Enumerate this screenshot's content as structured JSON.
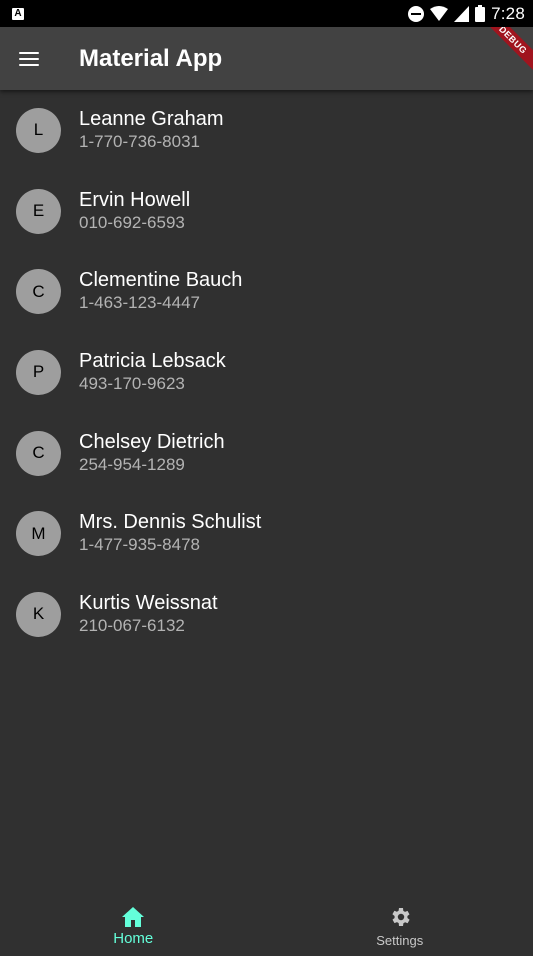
{
  "status_bar": {
    "notification_letter": "A",
    "time": "7:28",
    "icons": [
      "dnd-icon",
      "wifi-icon",
      "signal-icon",
      "battery-icon"
    ]
  },
  "app_bar": {
    "title": "Material App",
    "menu_icon": "menu-icon",
    "debug_label": "DEBUG"
  },
  "contacts": [
    {
      "initial": "L",
      "name": "Leanne Graham",
      "phone": "1-770-736-8031"
    },
    {
      "initial": "E",
      "name": "Ervin Howell",
      "phone": "010-692-6593"
    },
    {
      "initial": "C",
      "name": "Clementine Bauch",
      "phone": "1-463-123-4447"
    },
    {
      "initial": "P",
      "name": "Patricia Lebsack",
      "phone": "493-170-9623"
    },
    {
      "initial": "C",
      "name": "Chelsey Dietrich",
      "phone": "254-954-1289"
    },
    {
      "initial": "M",
      "name": "Mrs. Dennis Schulist",
      "phone": "1-477-935-8478"
    },
    {
      "initial": "K",
      "name": "Kurtis Weissnat",
      "phone": "210-067-6132"
    }
  ],
  "bottom_nav": {
    "items": [
      {
        "label": "Home",
        "icon": "home-icon",
        "active": true
      },
      {
        "label": "Settings",
        "icon": "gear-icon",
        "active": false
      }
    ]
  },
  "colors": {
    "background": "#303030",
    "app_bar": "#424242",
    "accent": "#64ffda",
    "avatar": "#9e9e9e",
    "debug_banner": "#a0141e"
  }
}
